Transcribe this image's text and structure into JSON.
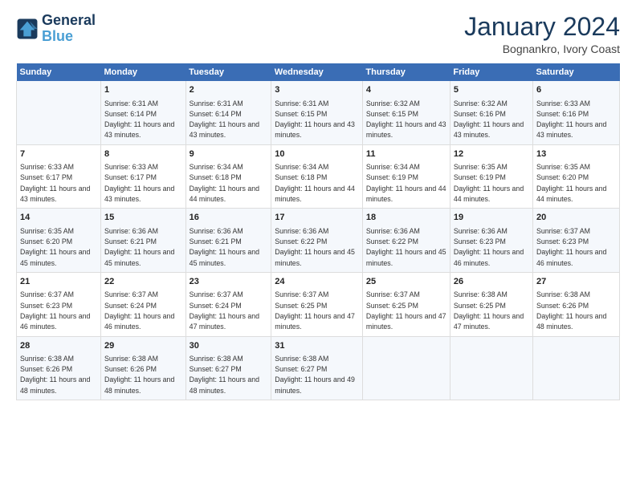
{
  "logo": {
    "line1": "General",
    "line2": "Blue"
  },
  "title": "January 2024",
  "subtitle": "Bognankro, Ivory Coast",
  "days_header": [
    "Sunday",
    "Monday",
    "Tuesday",
    "Wednesday",
    "Thursday",
    "Friday",
    "Saturday"
  ],
  "weeks": [
    [
      {
        "day": "",
        "sunrise": "",
        "sunset": "",
        "daylight": ""
      },
      {
        "day": "1",
        "sunrise": "Sunrise: 6:31 AM",
        "sunset": "Sunset: 6:14 PM",
        "daylight": "Daylight: 11 hours and 43 minutes."
      },
      {
        "day": "2",
        "sunrise": "Sunrise: 6:31 AM",
        "sunset": "Sunset: 6:14 PM",
        "daylight": "Daylight: 11 hours and 43 minutes."
      },
      {
        "day": "3",
        "sunrise": "Sunrise: 6:31 AM",
        "sunset": "Sunset: 6:15 PM",
        "daylight": "Daylight: 11 hours and 43 minutes."
      },
      {
        "day": "4",
        "sunrise": "Sunrise: 6:32 AM",
        "sunset": "Sunset: 6:15 PM",
        "daylight": "Daylight: 11 hours and 43 minutes."
      },
      {
        "day": "5",
        "sunrise": "Sunrise: 6:32 AM",
        "sunset": "Sunset: 6:16 PM",
        "daylight": "Daylight: 11 hours and 43 minutes."
      },
      {
        "day": "6",
        "sunrise": "Sunrise: 6:33 AM",
        "sunset": "Sunset: 6:16 PM",
        "daylight": "Daylight: 11 hours and 43 minutes."
      }
    ],
    [
      {
        "day": "7",
        "sunrise": "Sunrise: 6:33 AM",
        "sunset": "Sunset: 6:17 PM",
        "daylight": "Daylight: 11 hours and 43 minutes."
      },
      {
        "day": "8",
        "sunrise": "Sunrise: 6:33 AM",
        "sunset": "Sunset: 6:17 PM",
        "daylight": "Daylight: 11 hours and 43 minutes."
      },
      {
        "day": "9",
        "sunrise": "Sunrise: 6:34 AM",
        "sunset": "Sunset: 6:18 PM",
        "daylight": "Daylight: 11 hours and 44 minutes."
      },
      {
        "day": "10",
        "sunrise": "Sunrise: 6:34 AM",
        "sunset": "Sunset: 6:18 PM",
        "daylight": "Daylight: 11 hours and 44 minutes."
      },
      {
        "day": "11",
        "sunrise": "Sunrise: 6:34 AM",
        "sunset": "Sunset: 6:19 PM",
        "daylight": "Daylight: 11 hours and 44 minutes."
      },
      {
        "day": "12",
        "sunrise": "Sunrise: 6:35 AM",
        "sunset": "Sunset: 6:19 PM",
        "daylight": "Daylight: 11 hours and 44 minutes."
      },
      {
        "day": "13",
        "sunrise": "Sunrise: 6:35 AM",
        "sunset": "Sunset: 6:20 PM",
        "daylight": "Daylight: 11 hours and 44 minutes."
      }
    ],
    [
      {
        "day": "14",
        "sunrise": "Sunrise: 6:35 AM",
        "sunset": "Sunset: 6:20 PM",
        "daylight": "Daylight: 11 hours and 45 minutes."
      },
      {
        "day": "15",
        "sunrise": "Sunrise: 6:36 AM",
        "sunset": "Sunset: 6:21 PM",
        "daylight": "Daylight: 11 hours and 45 minutes."
      },
      {
        "day": "16",
        "sunrise": "Sunrise: 6:36 AM",
        "sunset": "Sunset: 6:21 PM",
        "daylight": "Daylight: 11 hours and 45 minutes."
      },
      {
        "day": "17",
        "sunrise": "Sunrise: 6:36 AM",
        "sunset": "Sunset: 6:22 PM",
        "daylight": "Daylight: 11 hours and 45 minutes."
      },
      {
        "day": "18",
        "sunrise": "Sunrise: 6:36 AM",
        "sunset": "Sunset: 6:22 PM",
        "daylight": "Daylight: 11 hours and 45 minutes."
      },
      {
        "day": "19",
        "sunrise": "Sunrise: 6:36 AM",
        "sunset": "Sunset: 6:23 PM",
        "daylight": "Daylight: 11 hours and 46 minutes."
      },
      {
        "day": "20",
        "sunrise": "Sunrise: 6:37 AM",
        "sunset": "Sunset: 6:23 PM",
        "daylight": "Daylight: 11 hours and 46 minutes."
      }
    ],
    [
      {
        "day": "21",
        "sunrise": "Sunrise: 6:37 AM",
        "sunset": "Sunset: 6:23 PM",
        "daylight": "Daylight: 11 hours and 46 minutes."
      },
      {
        "day": "22",
        "sunrise": "Sunrise: 6:37 AM",
        "sunset": "Sunset: 6:24 PM",
        "daylight": "Daylight: 11 hours and 46 minutes."
      },
      {
        "day": "23",
        "sunrise": "Sunrise: 6:37 AM",
        "sunset": "Sunset: 6:24 PM",
        "daylight": "Daylight: 11 hours and 47 minutes."
      },
      {
        "day": "24",
        "sunrise": "Sunrise: 6:37 AM",
        "sunset": "Sunset: 6:25 PM",
        "daylight": "Daylight: 11 hours and 47 minutes."
      },
      {
        "day": "25",
        "sunrise": "Sunrise: 6:37 AM",
        "sunset": "Sunset: 6:25 PM",
        "daylight": "Daylight: 11 hours and 47 minutes."
      },
      {
        "day": "26",
        "sunrise": "Sunrise: 6:38 AM",
        "sunset": "Sunset: 6:25 PM",
        "daylight": "Daylight: 11 hours and 47 minutes."
      },
      {
        "day": "27",
        "sunrise": "Sunrise: 6:38 AM",
        "sunset": "Sunset: 6:26 PM",
        "daylight": "Daylight: 11 hours and 48 minutes."
      }
    ],
    [
      {
        "day": "28",
        "sunrise": "Sunrise: 6:38 AM",
        "sunset": "Sunset: 6:26 PM",
        "daylight": "Daylight: 11 hours and 48 minutes."
      },
      {
        "day": "29",
        "sunrise": "Sunrise: 6:38 AM",
        "sunset": "Sunset: 6:26 PM",
        "daylight": "Daylight: 11 hours and 48 minutes."
      },
      {
        "day": "30",
        "sunrise": "Sunrise: 6:38 AM",
        "sunset": "Sunset: 6:27 PM",
        "daylight": "Daylight: 11 hours and 48 minutes."
      },
      {
        "day": "31",
        "sunrise": "Sunrise: 6:38 AM",
        "sunset": "Sunset: 6:27 PM",
        "daylight": "Daylight: 11 hours and 49 minutes."
      },
      {
        "day": "",
        "sunrise": "",
        "sunset": "",
        "daylight": ""
      },
      {
        "day": "",
        "sunrise": "",
        "sunset": "",
        "daylight": ""
      },
      {
        "day": "",
        "sunrise": "",
        "sunset": "",
        "daylight": ""
      }
    ]
  ]
}
